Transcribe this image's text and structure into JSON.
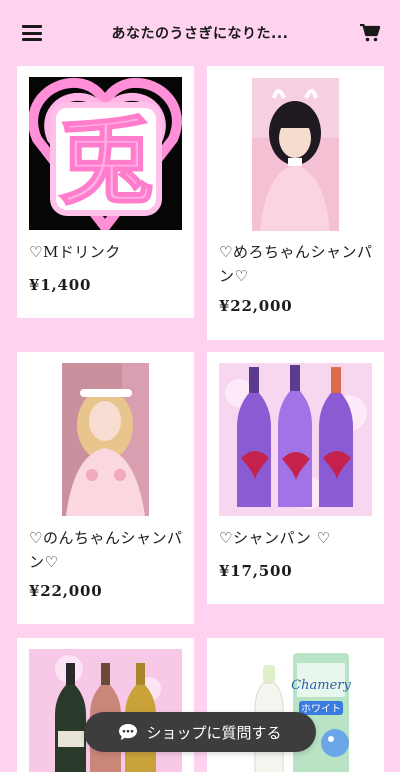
{
  "header": {
    "title": "あなたのうさぎになりた..."
  },
  "products": [
    {
      "name": "♡Mドリンク",
      "price": "¥1,400"
    },
    {
      "name": "♡めろちゃんシャンパン♡",
      "price": "¥22,000"
    },
    {
      "name": "♡のんちゃんシャンパン♡",
      "price": "¥22,000"
    },
    {
      "name": "♡シャンパン ♡",
      "price": "¥17,500"
    },
    {
      "name": "",
      "price": ""
    },
    {
      "name": "",
      "price": ""
    }
  ],
  "images": {
    "logo_text": "兎",
    "bottle_labels": [
      "Chamery",
      "ホワイト"
    ]
  },
  "chat": {
    "label": "ショップに質問する"
  },
  "colors": {
    "background": "#ffd3f0",
    "card": "#ffffff",
    "chat": "#3d3d3d"
  }
}
